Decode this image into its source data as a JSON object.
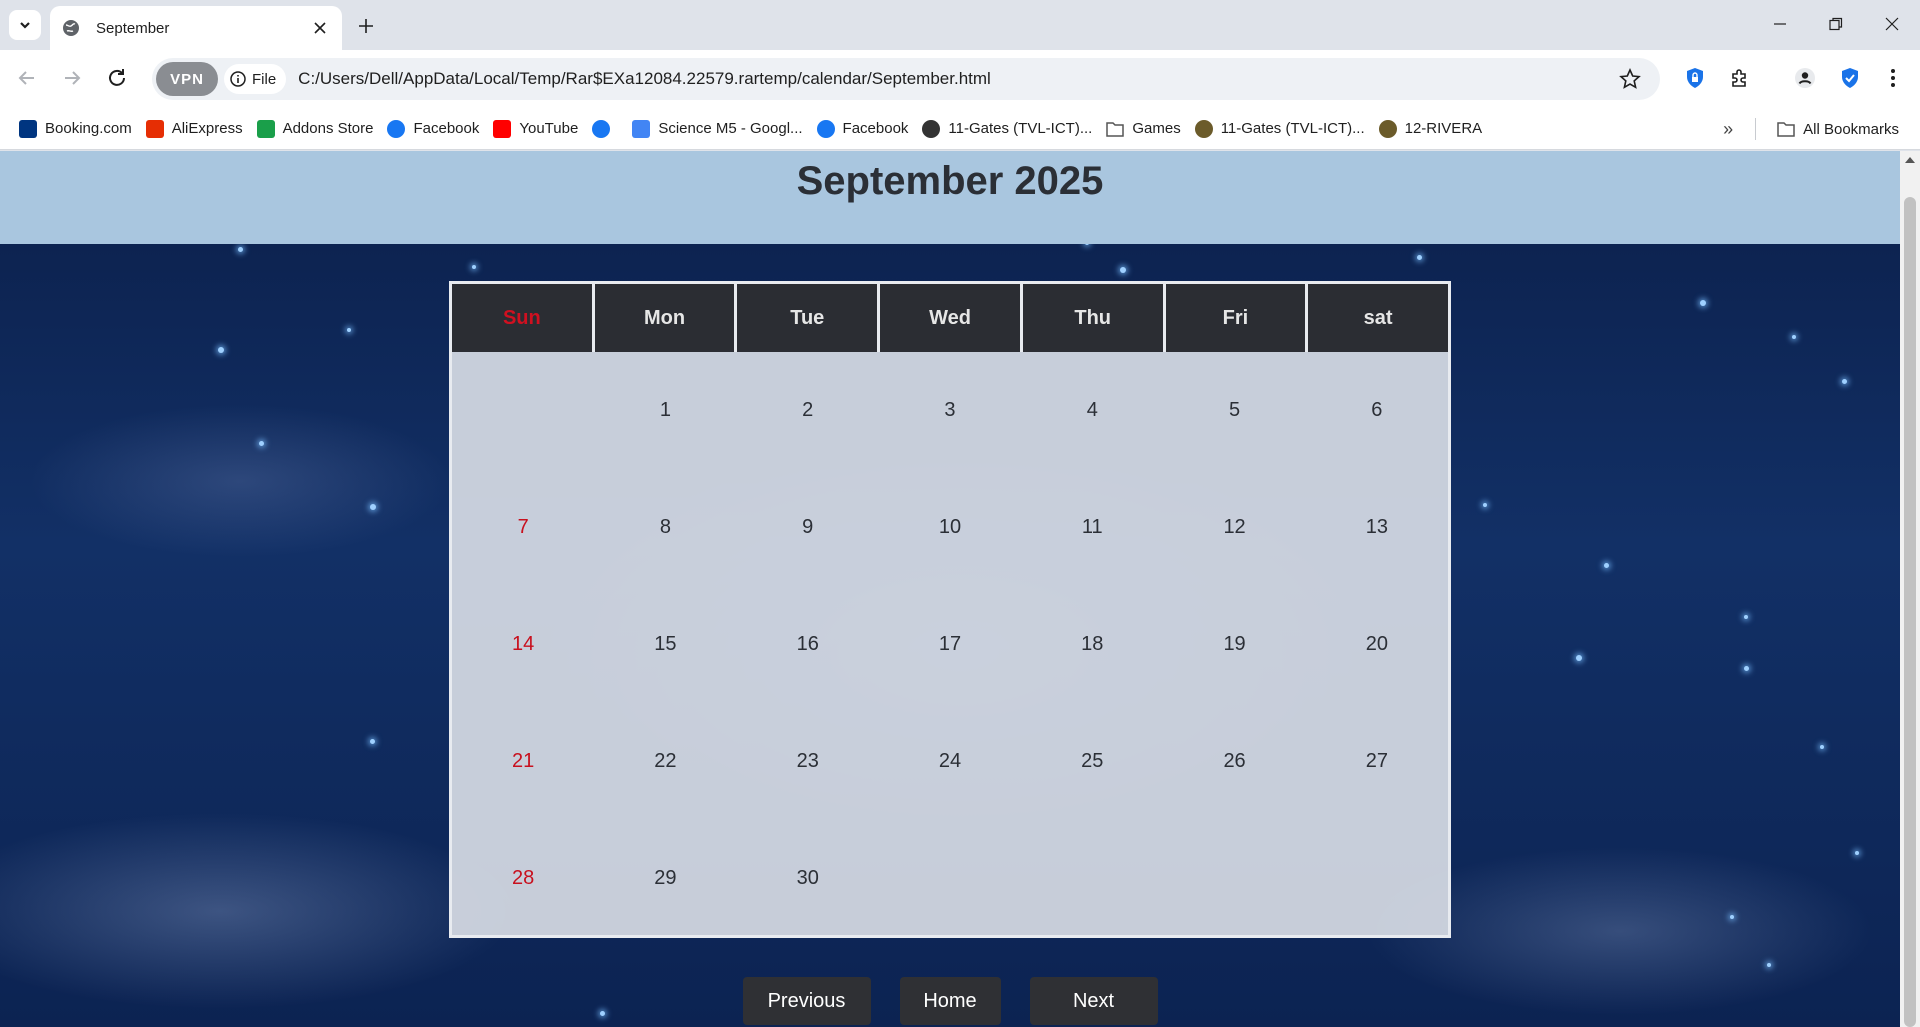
{
  "browser": {
    "tab_title": "September",
    "file_label": "File",
    "vpn_label": "VPN",
    "url": "C:/Users/Dell/AppData/Local/Temp/Rar$EXa12084.22579.rartemp/calendar/September.html",
    "bookmarks": [
      {
        "label": "Booking.com",
        "icon": "booking-icon",
        "color": "#003580"
      },
      {
        "label": "AliExpress",
        "icon": "aliexpress-icon",
        "color": "#e62e04"
      },
      {
        "label": "Addons Store",
        "icon": "addons-store-icon",
        "color": "#1a9f4a"
      },
      {
        "label": "Facebook",
        "icon": "facebook-icon",
        "color": "#1877f2"
      },
      {
        "label": "YouTube",
        "icon": "youtube-icon",
        "color": "#ff0000"
      },
      {
        "label": "",
        "icon": "facebook-icon",
        "color": "#1877f2"
      },
      {
        "label": "Science M5 - Googl...",
        "icon": "google-docs-icon",
        "color": "#4285f4"
      },
      {
        "label": "Facebook",
        "icon": "facebook-icon",
        "color": "#1877f2"
      },
      {
        "label": "11-Gates (TVL-ICT)...",
        "icon": "globe-icon",
        "color": "#333333"
      },
      {
        "label": "Games",
        "icon": "folder-icon",
        "color": "#555555"
      },
      {
        "label": "11-Gates (TVL-ICT)...",
        "icon": "school-icon",
        "color": "#6b5b2a"
      },
      {
        "label": "12-RIVERA",
        "icon": "school-icon",
        "color": "#6b5b2a"
      }
    ],
    "all_bookmarks_label": "All Bookmarks"
  },
  "page": {
    "title": "September 2025",
    "weekdays": [
      "Sun",
      "Mon",
      "Tue",
      "Wed",
      "Thu",
      "Fri",
      "sat"
    ],
    "days": [
      "",
      "1",
      "2",
      "3",
      "4",
      "5",
      "6",
      "7",
      "8",
      "9",
      "10",
      "11",
      "12",
      "13",
      "14",
      "15",
      "16",
      "17",
      "18",
      "19",
      "20",
      "21",
      "22",
      "23",
      "24",
      "25",
      "26",
      "27",
      "28",
      "29",
      "30",
      "",
      "",
      "",
      ""
    ],
    "buttons": {
      "previous": "Previous",
      "home": "Home",
      "next": "Next"
    },
    "colors": {
      "sunday": "#c8101e",
      "header_band": "#a9c6df",
      "weekday_header": "#2b2d33",
      "button": "#2f3034"
    }
  }
}
